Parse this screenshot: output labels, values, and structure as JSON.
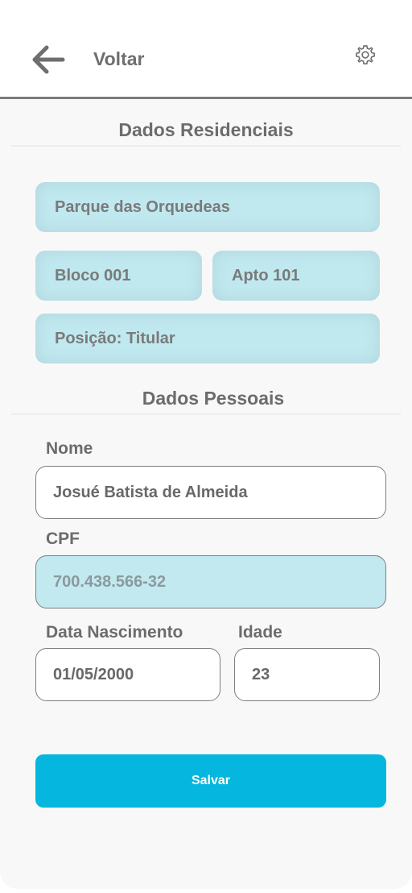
{
  "header": {
    "back_label": "Voltar",
    "back_icon": "arrow-left-icon",
    "settings_icon": "gear-icon"
  },
  "residential": {
    "title": "Dados Residenciais",
    "condominium": "Parque das Orquedeas",
    "block": "Bloco 001",
    "apartment": "Apto 101",
    "position": "Posição: Titular"
  },
  "personal": {
    "title": "Dados Pessoais",
    "name_label": "Nome",
    "name_value": "Josué Batista de Almeida",
    "cpf_label": "CPF",
    "cpf_value": "700.438.566-32",
    "birth_label": "Data Nascimento",
    "birth_value": "01/05/2000",
    "age_label": "Idade",
    "age_value": "23"
  },
  "actions": {
    "save_label": "Salvar"
  },
  "colors": {
    "accent": "#05b7de",
    "readonly_fill": "#c2e9f0",
    "text": "#6c6c6c"
  }
}
